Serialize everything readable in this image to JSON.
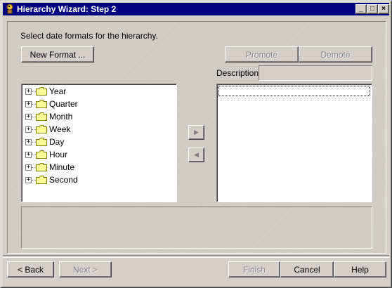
{
  "window": {
    "title": "Hierarchy Wizard: Step 2",
    "controls": {
      "minimize": "_",
      "maximize": "□",
      "close": "×"
    }
  },
  "instruction": "Select date formats for the hierarchy.",
  "buttons": {
    "new_format": "New Format ...",
    "promote": "Promote",
    "demote": "Demote",
    "back": "< Back",
    "next": "Next >",
    "finish": "Finish",
    "cancel": "Cancel",
    "help": "Help"
  },
  "description_label": "Description:",
  "description_value": "",
  "tree": {
    "items": [
      {
        "label": "Year",
        "expander": "+"
      },
      {
        "label": "Quarter",
        "expander": "+"
      },
      {
        "label": "Month",
        "expander": "+"
      },
      {
        "label": "Week",
        "expander": "+"
      },
      {
        "label": "Day",
        "expander": "+"
      },
      {
        "label": "Hour",
        "expander": "+"
      },
      {
        "label": "Minute",
        "expander": "+"
      },
      {
        "label": "Second",
        "expander": "+"
      }
    ]
  },
  "selected_list": {
    "items": []
  },
  "arrows": {
    "add": "▶",
    "remove": "◀"
  },
  "colors": {
    "titlebar": "#000080",
    "face": "#d4d0c8",
    "folder": "#ffff99"
  },
  "icons": {
    "title": "wizard-icon",
    "folder": "folder-icon"
  }
}
